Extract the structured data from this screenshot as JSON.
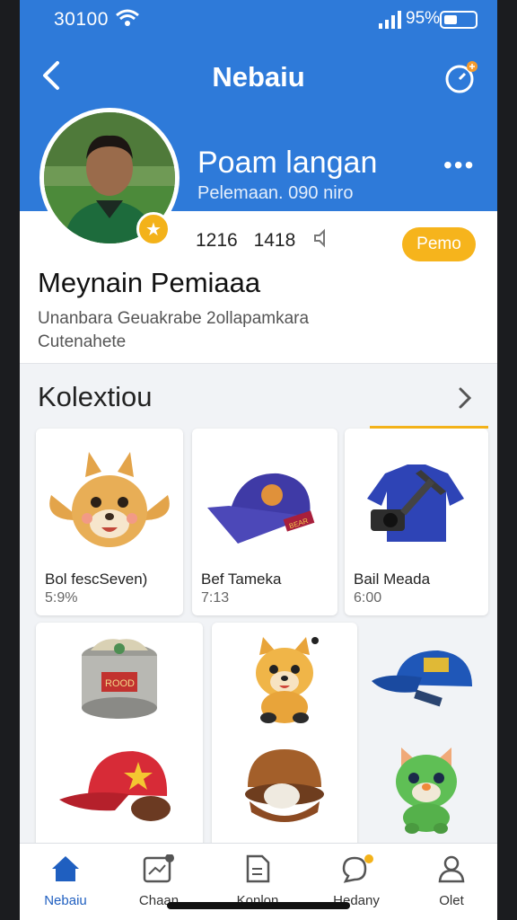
{
  "status_bar": {
    "time": "30100",
    "battery": "95%"
  },
  "header": {
    "title": "Nebaiu"
  },
  "profile": {
    "name": "Poam langan",
    "subtitle": "Pelemaan.  090 niro",
    "stat_1": "1216",
    "stat_2": "1418",
    "pill_label": "Pemo",
    "username": "Meynain Pemiaaa",
    "description": "Unanbara Geuakrabe 2ollapamkara Cutenahete"
  },
  "collection": {
    "title": "Kolextiou",
    "items": [
      {
        "name": "Bol fescSeven)",
        "price": "5:9%",
        "icon": "fox-plush-icon"
      },
      {
        "name": "Bef Tameka",
        "price": "7:13",
        "icon": "purple-cap-icon"
      },
      {
        "name": "Bail Meada",
        "price": "6:00",
        "icon": "blue-shirt-camera-icon"
      },
      {
        "name": "",
        "price": "",
        "icon": "tin-can-icon"
      },
      {
        "name": "",
        "price": "",
        "icon": "puppy-figure-icon"
      },
      {
        "name": "",
        "price": "",
        "icon": "blue-cap-icon"
      },
      {
        "name": "",
        "price": "",
        "icon": "red-cap-icon"
      },
      {
        "name": "",
        "price": "",
        "icon": "burger-icon"
      },
      {
        "name": "",
        "price": "",
        "icon": "green-cat-icon"
      }
    ]
  },
  "bottom_nav": [
    {
      "label": "Nebaiu",
      "icon": "home-icon",
      "active": true
    },
    {
      "label": "Chaan",
      "icon": "chart-card-icon"
    },
    {
      "label": "Konlon",
      "icon": "document-icon"
    },
    {
      "label": "Hedany",
      "icon": "chat-bubble-icon"
    },
    {
      "label": "Olet",
      "icon": "person-icon"
    }
  ],
  "colors": {
    "header_blue": "#2e7ad9",
    "accent_yellow": "#f3b21a",
    "nav_active": "#1f5fc0"
  }
}
